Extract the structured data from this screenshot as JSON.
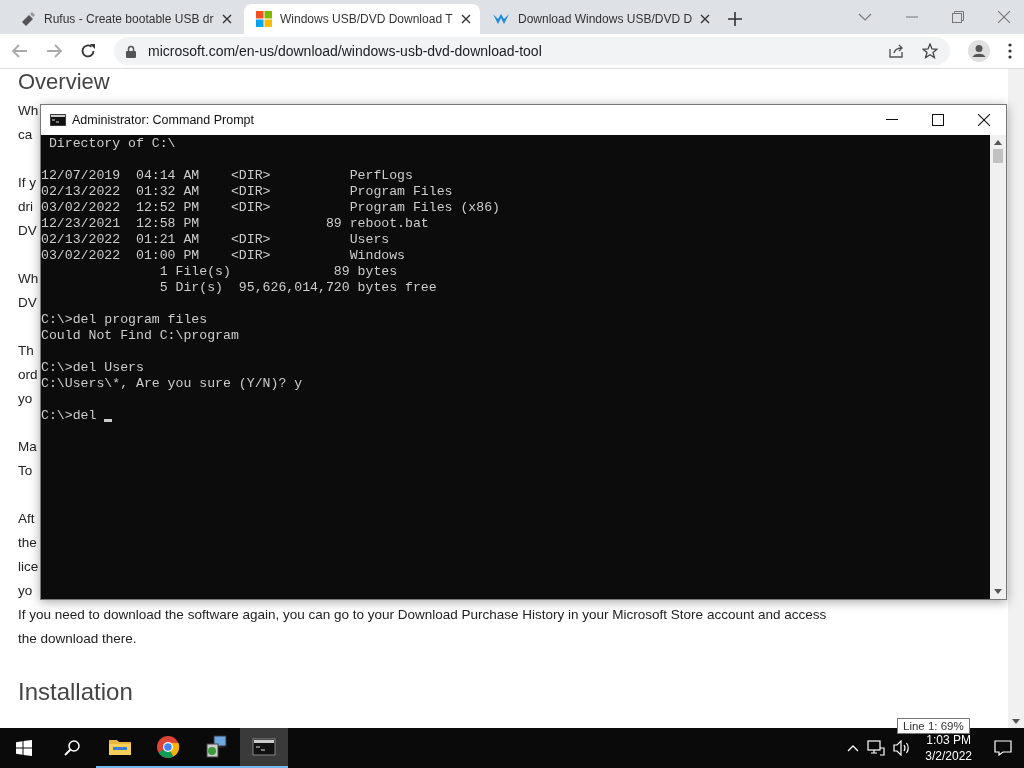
{
  "browser": {
    "tabs": [
      {
        "title": "Rufus - Create bootable USB dr",
        "kind": "usb",
        "selected": false
      },
      {
        "title": "Windows USB/DVD Download T",
        "kind": "windows",
        "selected": true
      },
      {
        "title": "Download Windows USB/DVD D",
        "kind": "logo",
        "selected": false
      }
    ],
    "url": "microsoft.com/en-us/download/windows-usb-dvd-download-tool"
  },
  "page": {
    "heading": "Overview",
    "paragraphs": [
      [
        "Wh",
        "ca"
      ],
      [
        "If y",
        "dri",
        "DV"
      ],
      [
        "Wh",
        "DV"
      ],
      [
        "Th",
        "ord",
        "yo"
      ],
      [
        "Ma",
        "To"
      ],
      [
        "Aft",
        "the",
        "lice",
        "yo",
        "If you need to download the software again, you can go to your Download Purchase History in your Microsoft Store account and access",
        "the download there."
      ]
    ],
    "heading_2": "Installation"
  },
  "console_window": {
    "title": "Administrator: Command Prompt",
    "blocks": [
      [
        " Directory of C:\\"
      ],
      [
        "12/07/2019  04:14 AM    <DIR>          PerfLogs",
        "02/13/2022  01:32 AM    <DIR>          Program Files",
        "03/02/2022  12:52 PM    <DIR>          Program Files (x86)",
        "12/23/2021  12:58 PM                89 reboot.bat",
        "02/13/2022  01:21 AM    <DIR>          Users",
        "03/02/2022  01:00 PM    <DIR>          Windows",
        "               1 File(s)             89 bytes",
        "               5 Dir(s)  95,626,014,720 bytes free"
      ],
      [
        "C:\\>del program files",
        "Could Not Find C:\\program"
      ],
      [
        "C:\\>del Users",
        "C:\\Users\\*, Are you sure (Y/N)? y"
      ],
      [
        "C:\\>del "
      ]
    ]
  },
  "taskbar": {
    "apps": [
      {
        "kind": "folder",
        "selected": false
      },
      {
        "kind": "chrome",
        "selected": false
      },
      {
        "kind": "installer",
        "selected": false
      },
      {
        "kind": "console",
        "selected": true
      }
    ],
    "time": "1:03 PM",
    "date": "3/2/2022"
  },
  "tooltip": "Line 1: 69%"
}
